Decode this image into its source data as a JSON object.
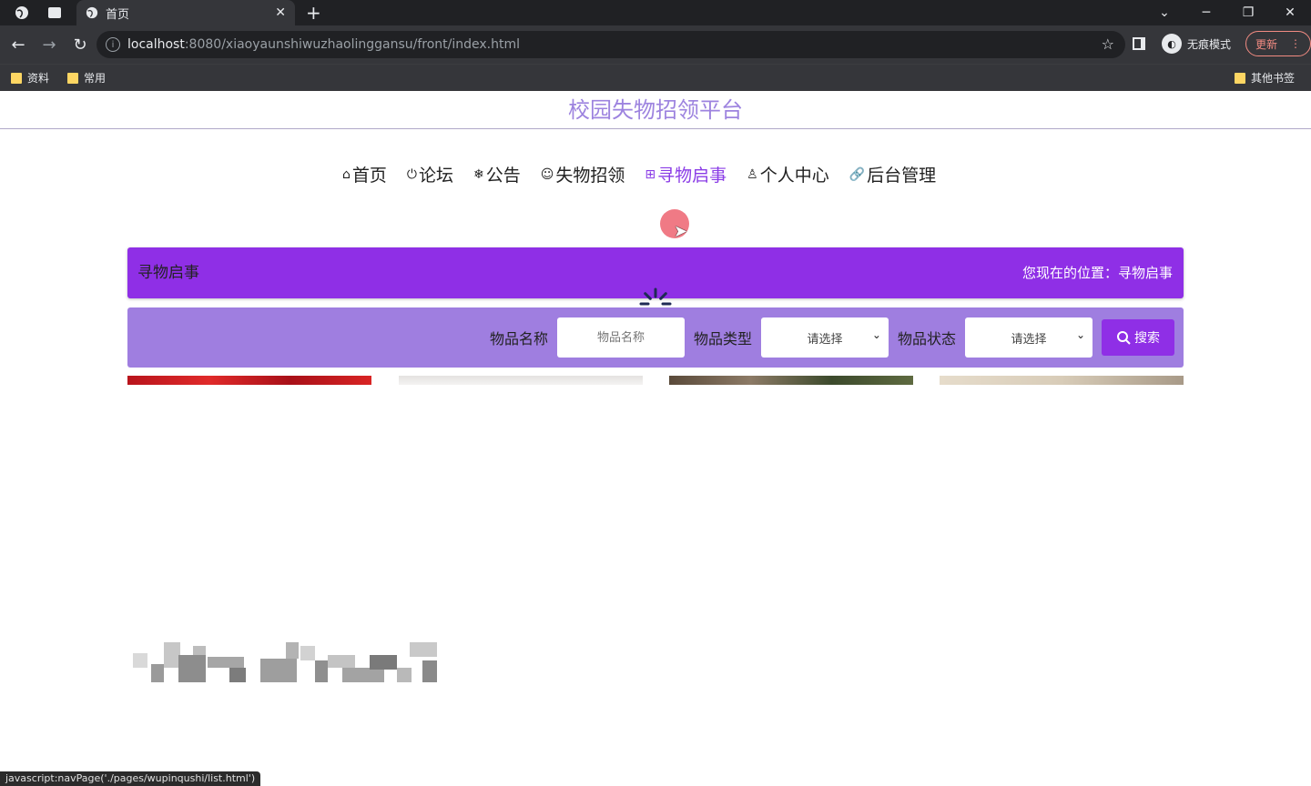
{
  "browser": {
    "tab_title": "首页",
    "url_host": "localhost",
    "url_path": ":8080/xiaoyaunshiwuzhaolinggansu/front/index.html",
    "incognito_label": "无痕模式",
    "update_label": "更新",
    "bookmarks": [
      "资料",
      "常用"
    ],
    "other_bookmarks": "其他书签"
  },
  "page": {
    "site_title": "校园失物招领平台",
    "menu": [
      {
        "icon": "⌂",
        "label": "首页"
      },
      {
        "icon": "⏻",
        "label": "论坛"
      },
      {
        "icon": "❄",
        "label": "公告"
      },
      {
        "icon": "☺",
        "label": "失物招领"
      },
      {
        "icon": "⊞",
        "label": "寻物启事"
      },
      {
        "icon": "♙",
        "label": "个人中心"
      },
      {
        "icon": "🔗",
        "label": "后台管理"
      }
    ],
    "active_menu": "寻物启事",
    "breadcrumb": {
      "title": "寻物启事",
      "position_label": "您现在的位置：",
      "position_value": "寻物启事"
    },
    "search": {
      "name_label": "物品名称",
      "name_placeholder": "物品名称",
      "type_label": "物品类型",
      "type_value": "请选择",
      "status_label": "物品状态",
      "status_value": "请选择",
      "button_label": "搜索"
    },
    "accent_color": "#8f2fe6",
    "search_bar_color": "#9f7ee0",
    "title_color": "#9d83df"
  },
  "status_text": "javascript:navPage('./pages/wupinqushi/list.html')"
}
